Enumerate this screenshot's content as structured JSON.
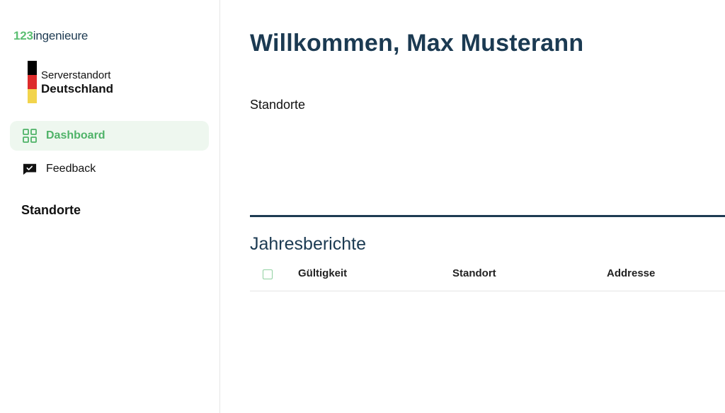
{
  "sidebar": {
    "brand": {
      "number": "123",
      "word": "ingenieure"
    },
    "badge": {
      "line1": "Serverstandort",
      "line2": "Deutschland",
      "flag_colors": [
        "#000000",
        "#dd2c2c",
        "#f2d44c"
      ]
    },
    "nav": [
      {
        "label": "Dashboard",
        "icon": "grid-icon",
        "active": true
      },
      {
        "label": "Feedback",
        "icon": "feedback-icon",
        "active": false
      }
    ],
    "section_title": "Standorte"
  },
  "main": {
    "welcome": "Willkommen, Max Musterann",
    "standorte_label": "Standorte",
    "reports": {
      "title": "Jahresberichte",
      "columns": [
        "Gültigkeit",
        "Standort",
        "Addresse"
      ]
    }
  },
  "colors": {
    "accent": "#4fb368",
    "accent_bg": "#eef7ef",
    "heading": "#1b3a52"
  }
}
